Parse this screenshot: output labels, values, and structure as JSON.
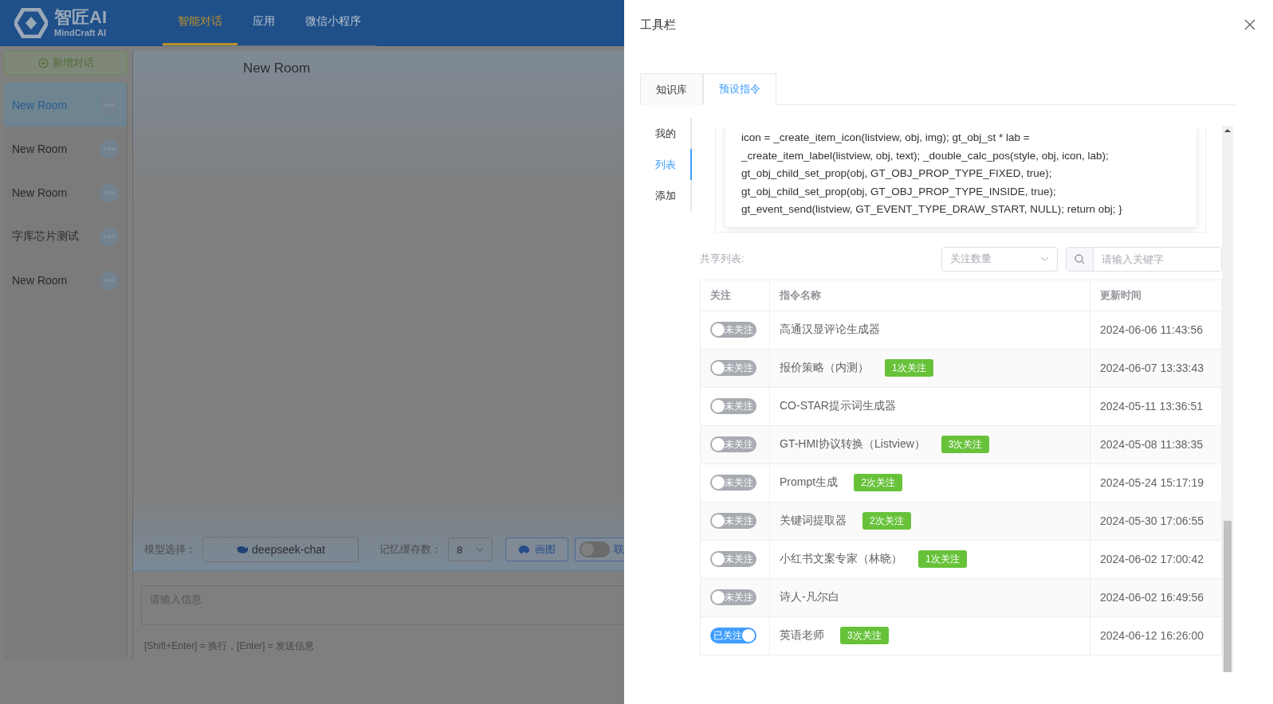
{
  "header": {
    "logo_title": "智匠AI",
    "logo_subtitle": "MindCraft AI",
    "nav": [
      {
        "label": "智能对话",
        "selected": true
      },
      {
        "label": "应用",
        "selected": false
      },
      {
        "label": "微信小程序",
        "selected": false
      }
    ]
  },
  "sidebar": {
    "new_button": "新增对话",
    "rooms": [
      {
        "name": "New Room",
        "selected": true
      },
      {
        "name": "New Room",
        "selected": false
      },
      {
        "name": "New Room",
        "selected": false
      },
      {
        "name": "字库芯片测试",
        "selected": false
      },
      {
        "name": "New Room",
        "selected": false
      }
    ]
  },
  "chat": {
    "title": "New Room",
    "model_label": "模型选择：",
    "model": "deepseek-chat",
    "memory_label": "记忆缓存数：",
    "memory_value": "8",
    "draw_button": "画图",
    "web_toggle": {
      "label": "联",
      "on": false
    },
    "input_placeholder": "请输入信息",
    "hint": "[Shift+Enter] = 换行，[Enter] = 发送信息"
  },
  "drawer": {
    "title": "工具栏",
    "tabs": [
      {
        "label": "知识库",
        "selected": false
      },
      {
        "label": "预设指令",
        "selected": true
      }
    ],
    "side_tabs": [
      {
        "label": "我的",
        "selected": false
      },
      {
        "label": "列表",
        "selected": true
      },
      {
        "label": "添加",
        "selected": false
      }
    ],
    "code_lines": [
      "icon = _create_item_icon(listview, obj, img); gt_obj_st * lab =",
      "_create_item_label(listview, obj, text); _double_calc_pos(style, obj, icon, lab);",
      "gt_obj_child_set_prop(obj, GT_OBJ_PROP_TYPE_FIXED, true);",
      "gt_obj_child_set_prop(obj, GT_OBJ_PROP_TYPE_INSIDE, true);",
      "gt_event_send(listview, GT_EVENT_TYPE_DRAW_START, NULL); return obj; }"
    ],
    "shared_label": "共享列表:",
    "sort_select": {
      "placeholder": "关注数量"
    },
    "search": {
      "placeholder": "请输入关键字"
    },
    "table": {
      "columns": [
        "关注",
        "指令名称",
        "更新时间"
      ],
      "rows": [
        {
          "follow": {
            "on": false,
            "label": "未关注"
          },
          "name": "高通汉显评论生成器",
          "updated": "2024-06-06 11:43:56"
        },
        {
          "follow": {
            "on": false,
            "label": "未关注"
          },
          "name": "报价策略（内测）",
          "tag": "1次关注",
          "updated": "2024-06-07 13:33:43"
        },
        {
          "follow": {
            "on": false,
            "label": "未关注"
          },
          "name": "CO-STAR提示词生成器",
          "updated": "2024-05-11 13:36:51"
        },
        {
          "follow": {
            "on": false,
            "label": "未关注"
          },
          "name": "GT-HMI协议转换（Listview）",
          "tag": "3次关注",
          "updated": "2024-05-08 11:38:35"
        },
        {
          "follow": {
            "on": false,
            "label": "未关注"
          },
          "name": "Prompt生成",
          "tag": "2次关注",
          "updated": "2024-05-24 15:17:19"
        },
        {
          "follow": {
            "on": false,
            "label": "未关注"
          },
          "name": "关键词提取器",
          "tag": "2次关注",
          "updated": "2024-05-30 17:06:55"
        },
        {
          "follow": {
            "on": false,
            "label": "未关注"
          },
          "name": "小红书文案专家（林晓）",
          "tag": "1次关注",
          "updated": "2024-06-02 17:00:42"
        },
        {
          "follow": {
            "on": false,
            "label": "未关注"
          },
          "name": "诗人-凡尔白",
          "updated": "2024-06-02 16:49:56"
        },
        {
          "follow": {
            "on": true,
            "label": "已关注"
          },
          "name": "英语老师",
          "tag": "3次关注",
          "updated": "2024-06-12 16:26:00"
        }
      ]
    }
  }
}
